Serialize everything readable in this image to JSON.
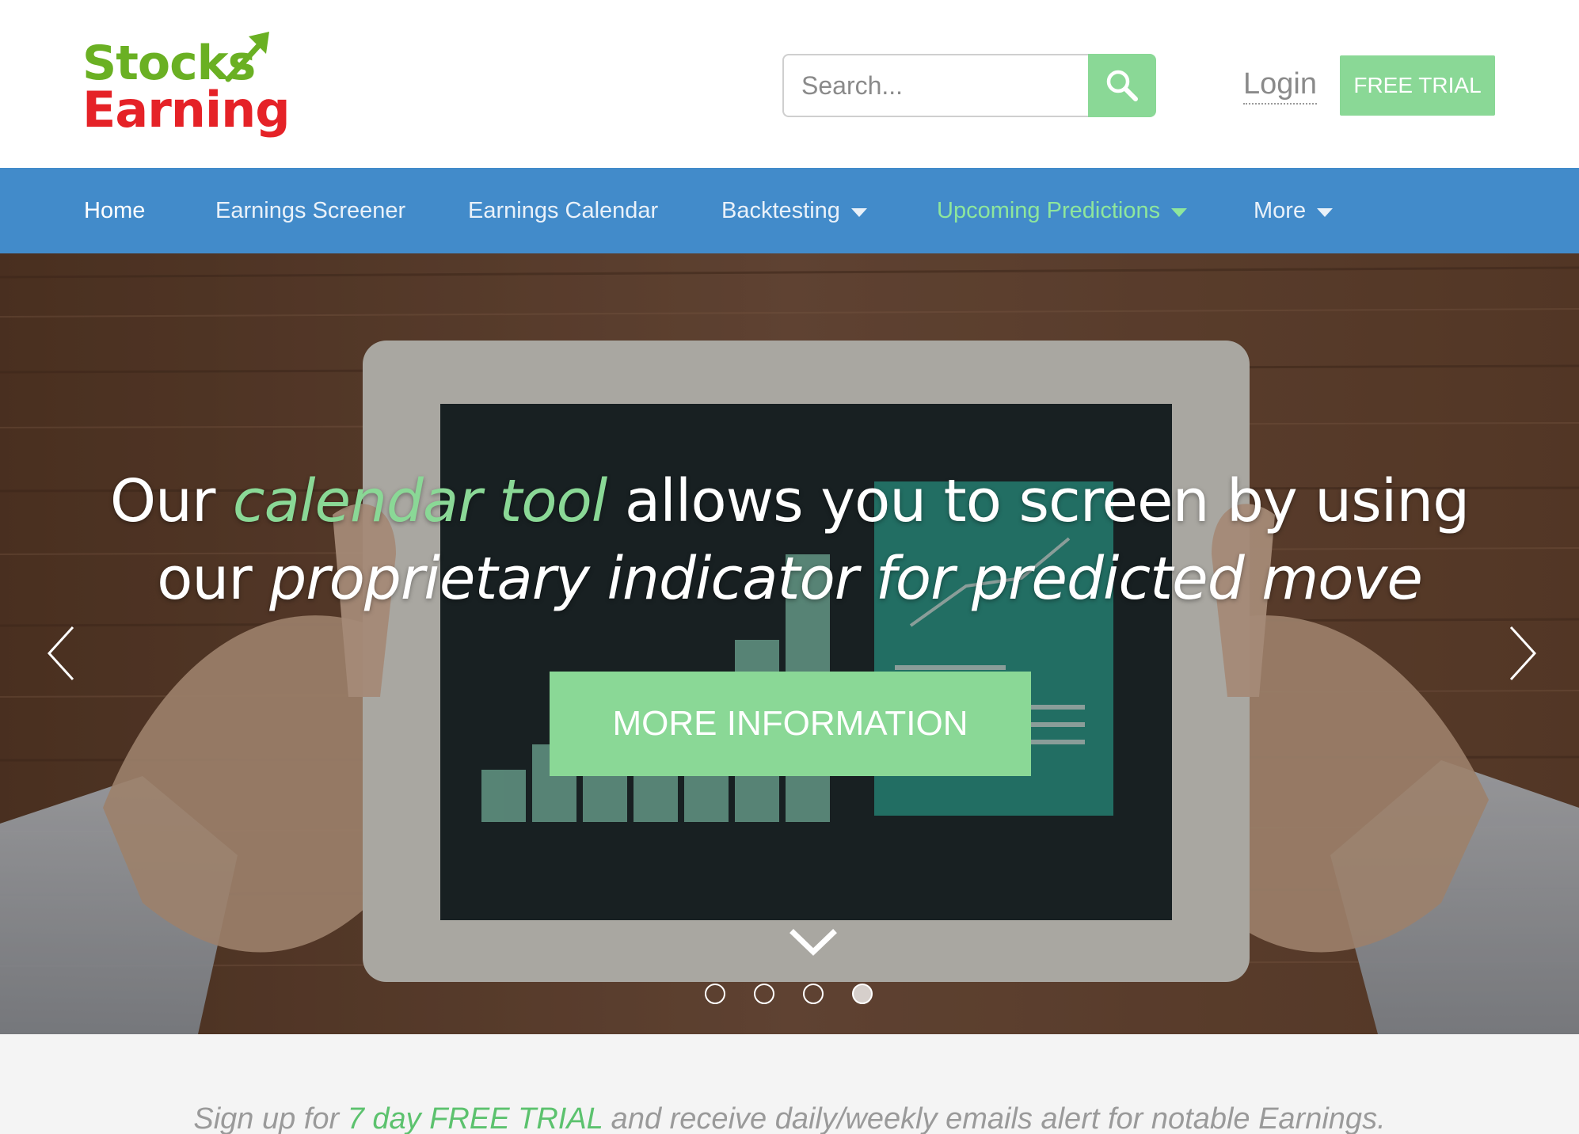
{
  "logo": {
    "line1": "Stocks",
    "line2": "Earning"
  },
  "search": {
    "placeholder": "Search...",
    "icon": "search-icon"
  },
  "header": {
    "login_label": "Login",
    "free_trial_label": "FREE TRIAL"
  },
  "nav": {
    "items": [
      {
        "label": "Home",
        "active": true,
        "dropdown": false
      },
      {
        "label": "Earnings Screener",
        "active": false,
        "dropdown": false
      },
      {
        "label": "Earnings Calendar",
        "active": false,
        "dropdown": false
      },
      {
        "label": "Backtesting",
        "active": false,
        "dropdown": true
      },
      {
        "label": "Upcoming Predictions",
        "active": false,
        "dropdown": true,
        "highlight": true
      },
      {
        "label": "More",
        "active": false,
        "dropdown": true
      }
    ]
  },
  "hero": {
    "text_prefix": "Our ",
    "text_accent": "calendar tool",
    "text_mid": " allows you to screen by using",
    "text_line2_prefix": "our ",
    "text_line2_em": "proprietary indicator for predicted move",
    "button_label": "MORE INFORMATION",
    "slide_count": 4,
    "active_slide": 4,
    "left_arrow_icon": "chevron-left-icon",
    "right_arrow_icon": "chevron-right-icon",
    "scroll_icon": "chevron-down-icon"
  },
  "signup": {
    "prefix": "Sign up for ",
    "accent": "7 day FREE TRIAL",
    "suffix": " and receive daily/weekly emails alert for notable Earnings."
  },
  "colors": {
    "brand_green": "#8ad896",
    "nav_blue": "#428bca",
    "logo_green": "#6ab023",
    "logo_red": "#e52227"
  }
}
